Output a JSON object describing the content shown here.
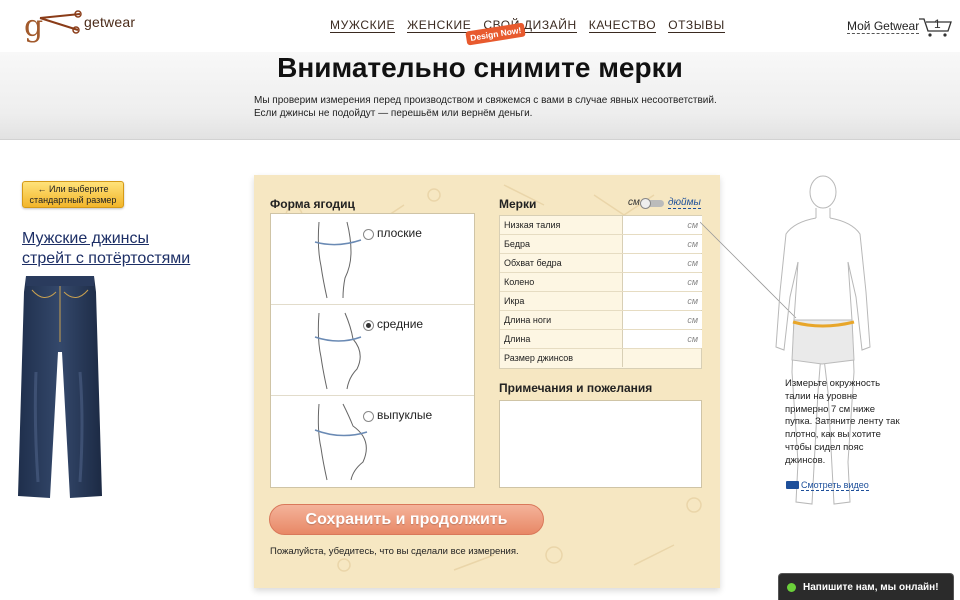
{
  "header": {
    "logo_text": "getwear",
    "nav": [
      "МУЖСКИЕ",
      "ЖЕНСКИЕ",
      "СВОЙ ДИЗАЙН",
      "КАЧЕСТВО",
      "ОТЗЫВЫ"
    ],
    "design_badge": "Design Now!",
    "account_link": "Мой Getwear",
    "cart_count": "1"
  },
  "banner": {
    "title": "Внимательно снимите мерки",
    "text": "Мы проверим измерения перед производством и свяжемся с вами в случае явных несоответствий. Если джинсы не подойдут — перешьём или вернём деньги."
  },
  "left": {
    "standard_size_button": "← Или выберите стандартный размер",
    "product_title": "Мужские джинсы стрейт с потёртостями"
  },
  "form": {
    "hip_title": "Форма ягодиц",
    "hip_options": [
      {
        "label": "плоские",
        "checked": false
      },
      {
        "label": "средние",
        "checked": true
      },
      {
        "label": "выпуклые",
        "checked": false
      }
    ],
    "measures_title": "Мерки",
    "unit_cm": "см",
    "unit_in": "дюймы",
    "measurements": [
      {
        "label": "Низкая талия",
        "unit": "см"
      },
      {
        "label": "Бедра",
        "unit": "см"
      },
      {
        "label": "Обхват бедра",
        "unit": "см"
      },
      {
        "label": "Колено",
        "unit": "см"
      },
      {
        "label": "Икра",
        "unit": "см"
      },
      {
        "label": "Длина ноги",
        "unit": "см"
      },
      {
        "label": "Длина",
        "unit": "см"
      },
      {
        "label": "Размер джинсов",
        "unit": ""
      }
    ],
    "notes_title": "Примечания и пожелания",
    "save_button": "Сохранить и продолжить",
    "save_hint": "Пожалуйста, убедитесь, что вы сделали все измерения."
  },
  "right": {
    "hint": "Измерьте окружность талии на уровне примерно 7 см ниже пупка. Затяните ленту так плотно, как вы хотите чтобы сидел пояс джинсов.",
    "video_link": "Смотреть видео"
  },
  "chat": {
    "label": "Напишите нам, мы онлайн!"
  },
  "colors": {
    "accent": "#e85a2e",
    "panel": "#f6e7c2",
    "button": "#e88866",
    "link": "#1d4f9a"
  }
}
